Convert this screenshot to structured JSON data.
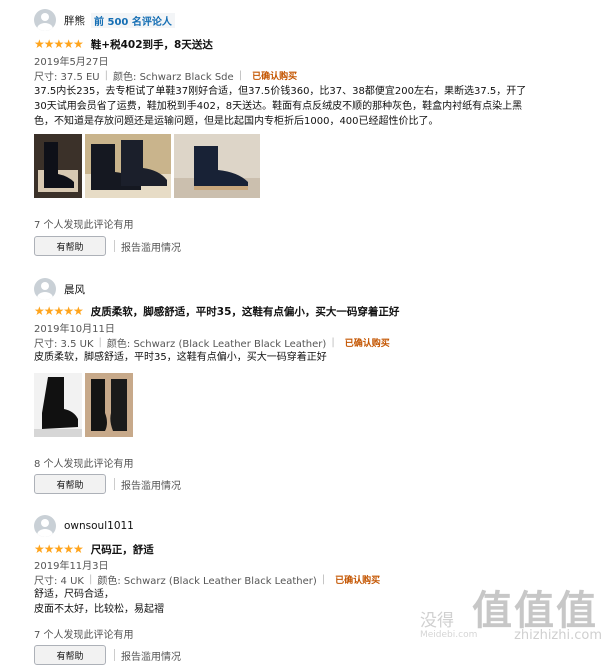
{
  "reviews": [
    {
      "reviewer": "胖熊",
      "badge": "前 500 名评论人",
      "stars": "★★★★★",
      "title": "鞋+税402到手，8天送达",
      "date": "2019年5月27日",
      "size": "尺寸: 37.5 EU",
      "color": "颜色: Schwarz Black Sde",
      "verified": "已确认购买",
      "body_lines": [
        "37.5内长235，去专柜试了单鞋37刚好合适，但37.5价钱360，比37、38都便宜200左右，果断选37.5，开了",
        "30天试用会员省了运费，鞋加税到手402，8天送达。鞋面有点反绒皮不顺的那种灰色，鞋盒内衬纸有点染上黑",
        "色，不知道是存放问题还是运输问题，但是比起国内专柜折后1000，400已经超性价比了。"
      ],
      "helpful_count": "7 个人发现此评论有用",
      "helpful_button": "有帮助",
      "report": "报告滥用情况"
    },
    {
      "reviewer": "晨风",
      "stars": "★★★★★",
      "title": "皮质柔软，脚感舒适，平时35，这鞋有点偏小，买大一码穿着正好",
      "date": "2019年10月11日",
      "size": "尺寸: 3.5 UK",
      "color": "颜色: Schwarz (Black Leather Black Leather)",
      "verified": "已确认购买",
      "body_lines": [
        "皮质柔软，脚感舒适，平时35，这鞋有点偏小，买大一码穿着正好"
      ],
      "helpful_count": "8 个人发现此评论有用",
      "helpful_button": "有帮助",
      "report": "报告滥用情况"
    },
    {
      "reviewer": "ownsoul1011",
      "stars": "★★★★★",
      "title": "尺码正，舒适",
      "date": "2019年11月3日",
      "size": "尺寸: 4 UK",
      "color": "颜色: Schwarz (Black Leather Black Leather)",
      "verified": "已确认购买",
      "body_lines": [
        "舒适，尺码合适，",
        "皮面不太好，比较松，易起褶"
      ],
      "helpful_count": "7 个人发现此评论有用",
      "helpful_button": "有帮助",
      "report": "报告滥用情况"
    }
  ],
  "watermark": {
    "big": "值值值",
    "small": "没得",
    "url": "zhizhizhi.com",
    "url2": "Meidebi.com"
  },
  "colors": {
    "star": "#ffa41c",
    "verified": "#c45500",
    "badge": "#146eb4"
  }
}
